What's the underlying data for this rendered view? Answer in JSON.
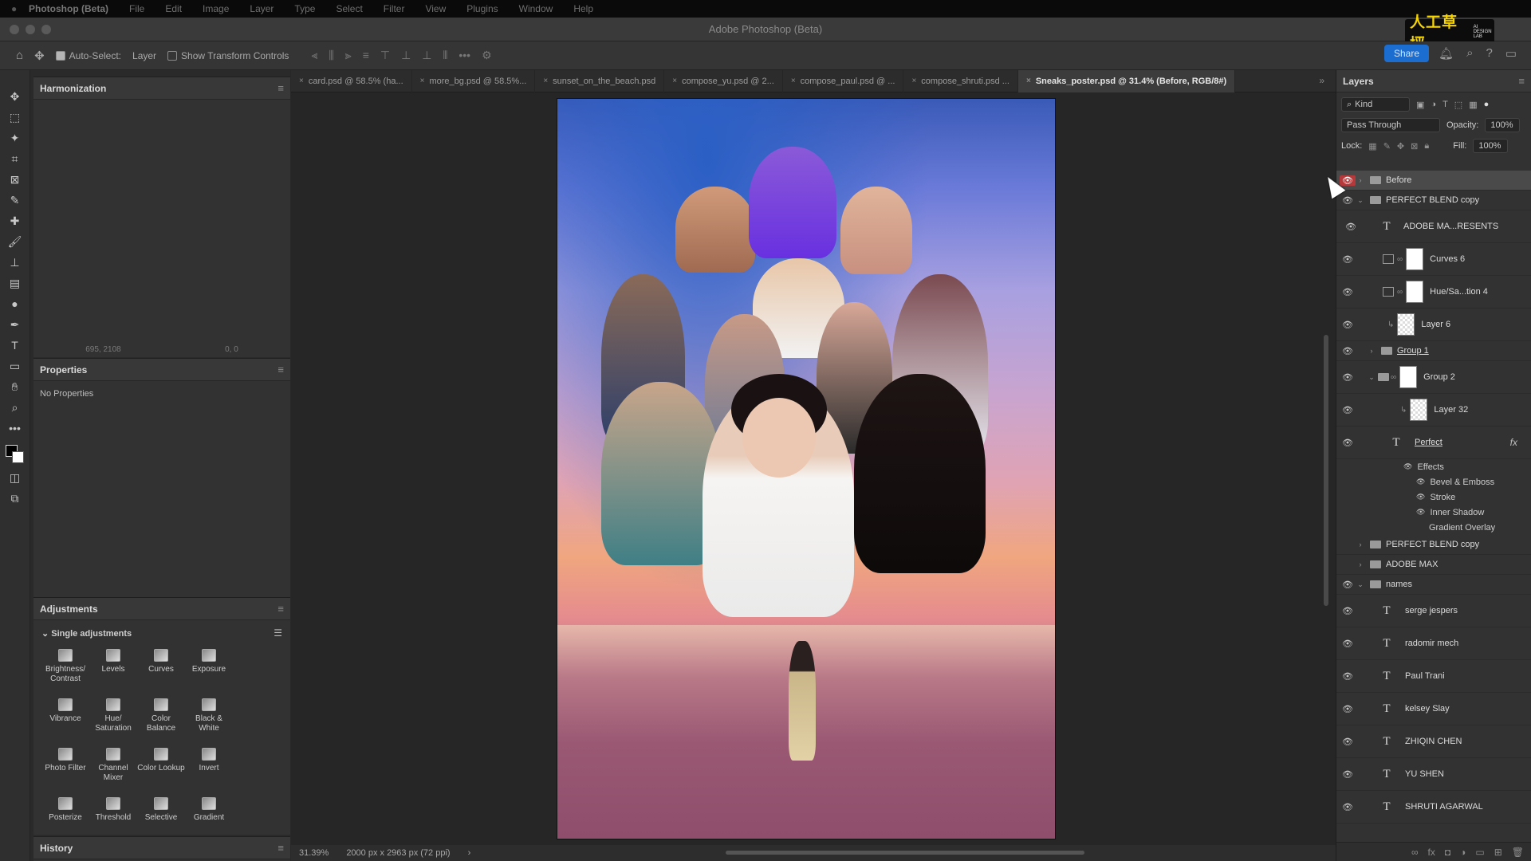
{
  "menubar": {
    "items": [
      "Photoshop (Beta)",
      "File",
      "Edit",
      "Image",
      "Layer",
      "Type",
      "Select",
      "Filter",
      "View",
      "Plugins",
      "Window",
      "Help"
    ]
  },
  "window": {
    "title": "Adobe Photoshop (Beta)"
  },
  "logo": {
    "cn": "人工草坪",
    "en": "AI DESIGN LAB"
  },
  "options": {
    "auto_select_label": "Auto-Select:",
    "auto_select_target": "Layer",
    "show_transform_label": "Show Transform Controls",
    "share_label": "Share"
  },
  "panels": {
    "harmonization": {
      "title": "Harmonization",
      "coord_left": "695, 2108",
      "coord_right": "0, 0"
    },
    "properties": {
      "title": "Properties",
      "body": "No Properties"
    },
    "adjustments": {
      "title": "Adjustments",
      "section": "Single adjustments",
      "items": [
        {
          "label": "Brightness/ Contrast"
        },
        {
          "label": "Levels"
        },
        {
          "label": "Curves"
        },
        {
          "label": "Exposure"
        },
        {
          "label": "Vibrance"
        },
        {
          "label": "Hue/ Saturation"
        },
        {
          "label": "Color Balance"
        },
        {
          "label": "Black & White"
        },
        {
          "label": "Photo Filter"
        },
        {
          "label": "Channel Mixer"
        },
        {
          "label": "Color Lookup"
        },
        {
          "label": "Invert"
        },
        {
          "label": "Posterize"
        },
        {
          "label": "Threshold"
        },
        {
          "label": "Selective"
        },
        {
          "label": "Gradient"
        }
      ]
    },
    "history": {
      "title": "History"
    }
  },
  "tabs": [
    {
      "label": "card.psd @ 58.5% (ha..."
    },
    {
      "label": "more_bg.psd @ 58.5%..."
    },
    {
      "label": "sunset_on_the_beach.psd"
    },
    {
      "label": "compose_yu.psd @ 2..."
    },
    {
      "label": "compose_paul.psd @ ..."
    },
    {
      "label": "compose_shruti.psd ..."
    },
    {
      "label": "Sneaks_poster.psd @ 31.4% (Before, RGB/8#)"
    }
  ],
  "status": {
    "zoom": "31.39%",
    "doc_size": "2000 px x 2963 px (72 ppi)"
  },
  "layers_panel": {
    "title": "Layers",
    "filter_kind": "Kind",
    "blend_mode": "Pass Through",
    "opacity_label": "Opacity:",
    "opacity_value": "100%",
    "lock_label": "Lock:",
    "fill_label": "Fill:",
    "fill_value": "100%",
    "rows": [
      {
        "name": "Before"
      },
      {
        "name": "PERFECT BLEND copy"
      },
      {
        "name": "ADOBE MA...RESENTS"
      },
      {
        "name": "Curves 6"
      },
      {
        "name": "Hue/Sa...tion 4"
      },
      {
        "name": "Layer 6"
      },
      {
        "name": "Group 1"
      },
      {
        "name": "Group 2"
      },
      {
        "name": "Layer 32"
      },
      {
        "name": "Perfect"
      },
      {
        "name": "PERFECT BLEND copy"
      },
      {
        "name": "ADOBE MAX"
      },
      {
        "name": "names"
      },
      {
        "name": "serge jespers"
      },
      {
        "name": "radomir mech"
      },
      {
        "name": "Paul Trani"
      },
      {
        "name": "kelsey Slay"
      },
      {
        "name": "ZHIQIN CHEN"
      },
      {
        "name": "YU SHEN"
      },
      {
        "name": "SHRUTI AGARWAL"
      }
    ],
    "effects": {
      "header": "Effects",
      "items": [
        "Bevel & Emboss",
        "Stroke",
        "Inner Shadow",
        "Gradient Overlay"
      ]
    }
  }
}
